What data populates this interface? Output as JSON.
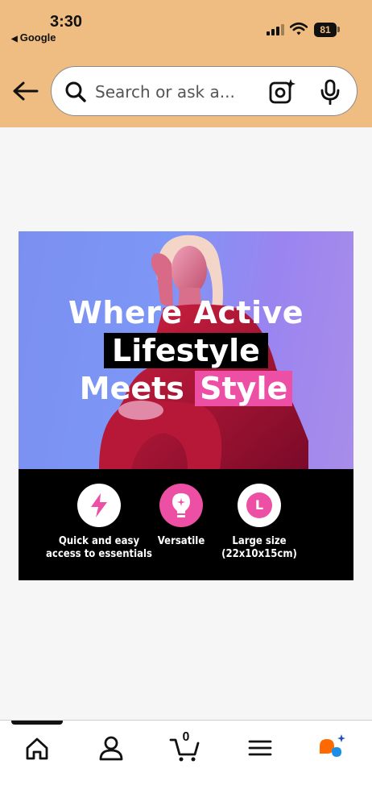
{
  "status_bar": {
    "time": "3:30",
    "back_app": "Google",
    "battery": "81"
  },
  "search": {
    "placeholder": "Search or ask a..."
  },
  "banner": {
    "headline_line1": "Where Active",
    "headline_line2": "Lifestyle",
    "headline_line3_a": "Meets",
    "headline_line3_b": "Style",
    "features": [
      {
        "label": "Quick and easy\naccess to essentials",
        "icon": "lightning-icon"
      },
      {
        "label": "Versatile",
        "icon": "lightbulb-icon"
      },
      {
        "label": "Large size\n(22x10x15cm)",
        "icon": "size-l-icon",
        "letter": "L"
      }
    ],
    "colors": {
      "accent": "#ec4fa4",
      "background": "#000000"
    }
  },
  "tabbar": {
    "cart_count": "0",
    "items": [
      "home-icon",
      "account-icon",
      "cart-icon",
      "menu-icon",
      "rufus-icon"
    ]
  },
  "colors": {
    "header": "#efbd82",
    "page": "#f6f6f6"
  }
}
